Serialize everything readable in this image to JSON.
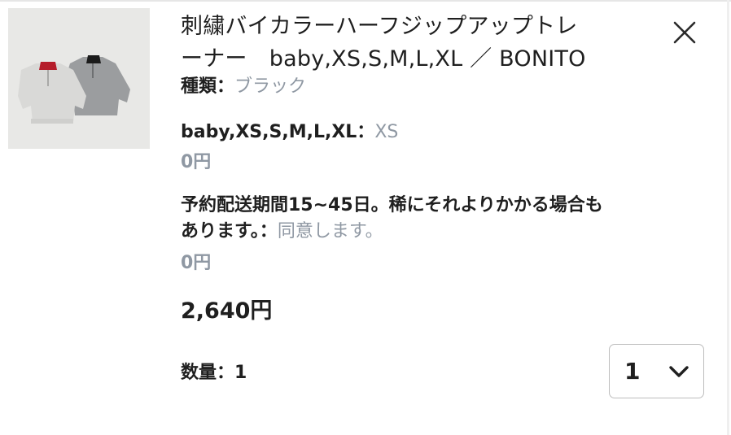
{
  "product": {
    "title_line1": "刺繍バイカラーハーフジップアップトレ",
    "title_line2": "ーナー　baby,XS,S,M,L,XL ／ BONITO",
    "image_icon": "product-thumbnail-two-sweatshirts"
  },
  "close": {
    "icon": "close-icon"
  },
  "options": [
    {
      "label": "種類：",
      "value": "ブラック"
    },
    {
      "label": "baby,XS,S,M,L,XL：",
      "value": "XS",
      "price": "0円"
    }
  ],
  "notice": {
    "line1": "予約配送期間15~45日。稀にそれよりかかる場合も",
    "line2_label": "あります。：",
    "line2_value": "同意します。",
    "price": "0円"
  },
  "total": "2,640円",
  "quantity": {
    "label": "数量：1",
    "selected": "1",
    "icon": "chevron-down-icon"
  },
  "colors": {
    "text": "#1f1f1f",
    "muted": "#8f98a3",
    "border": "#bdbdbd"
  }
}
